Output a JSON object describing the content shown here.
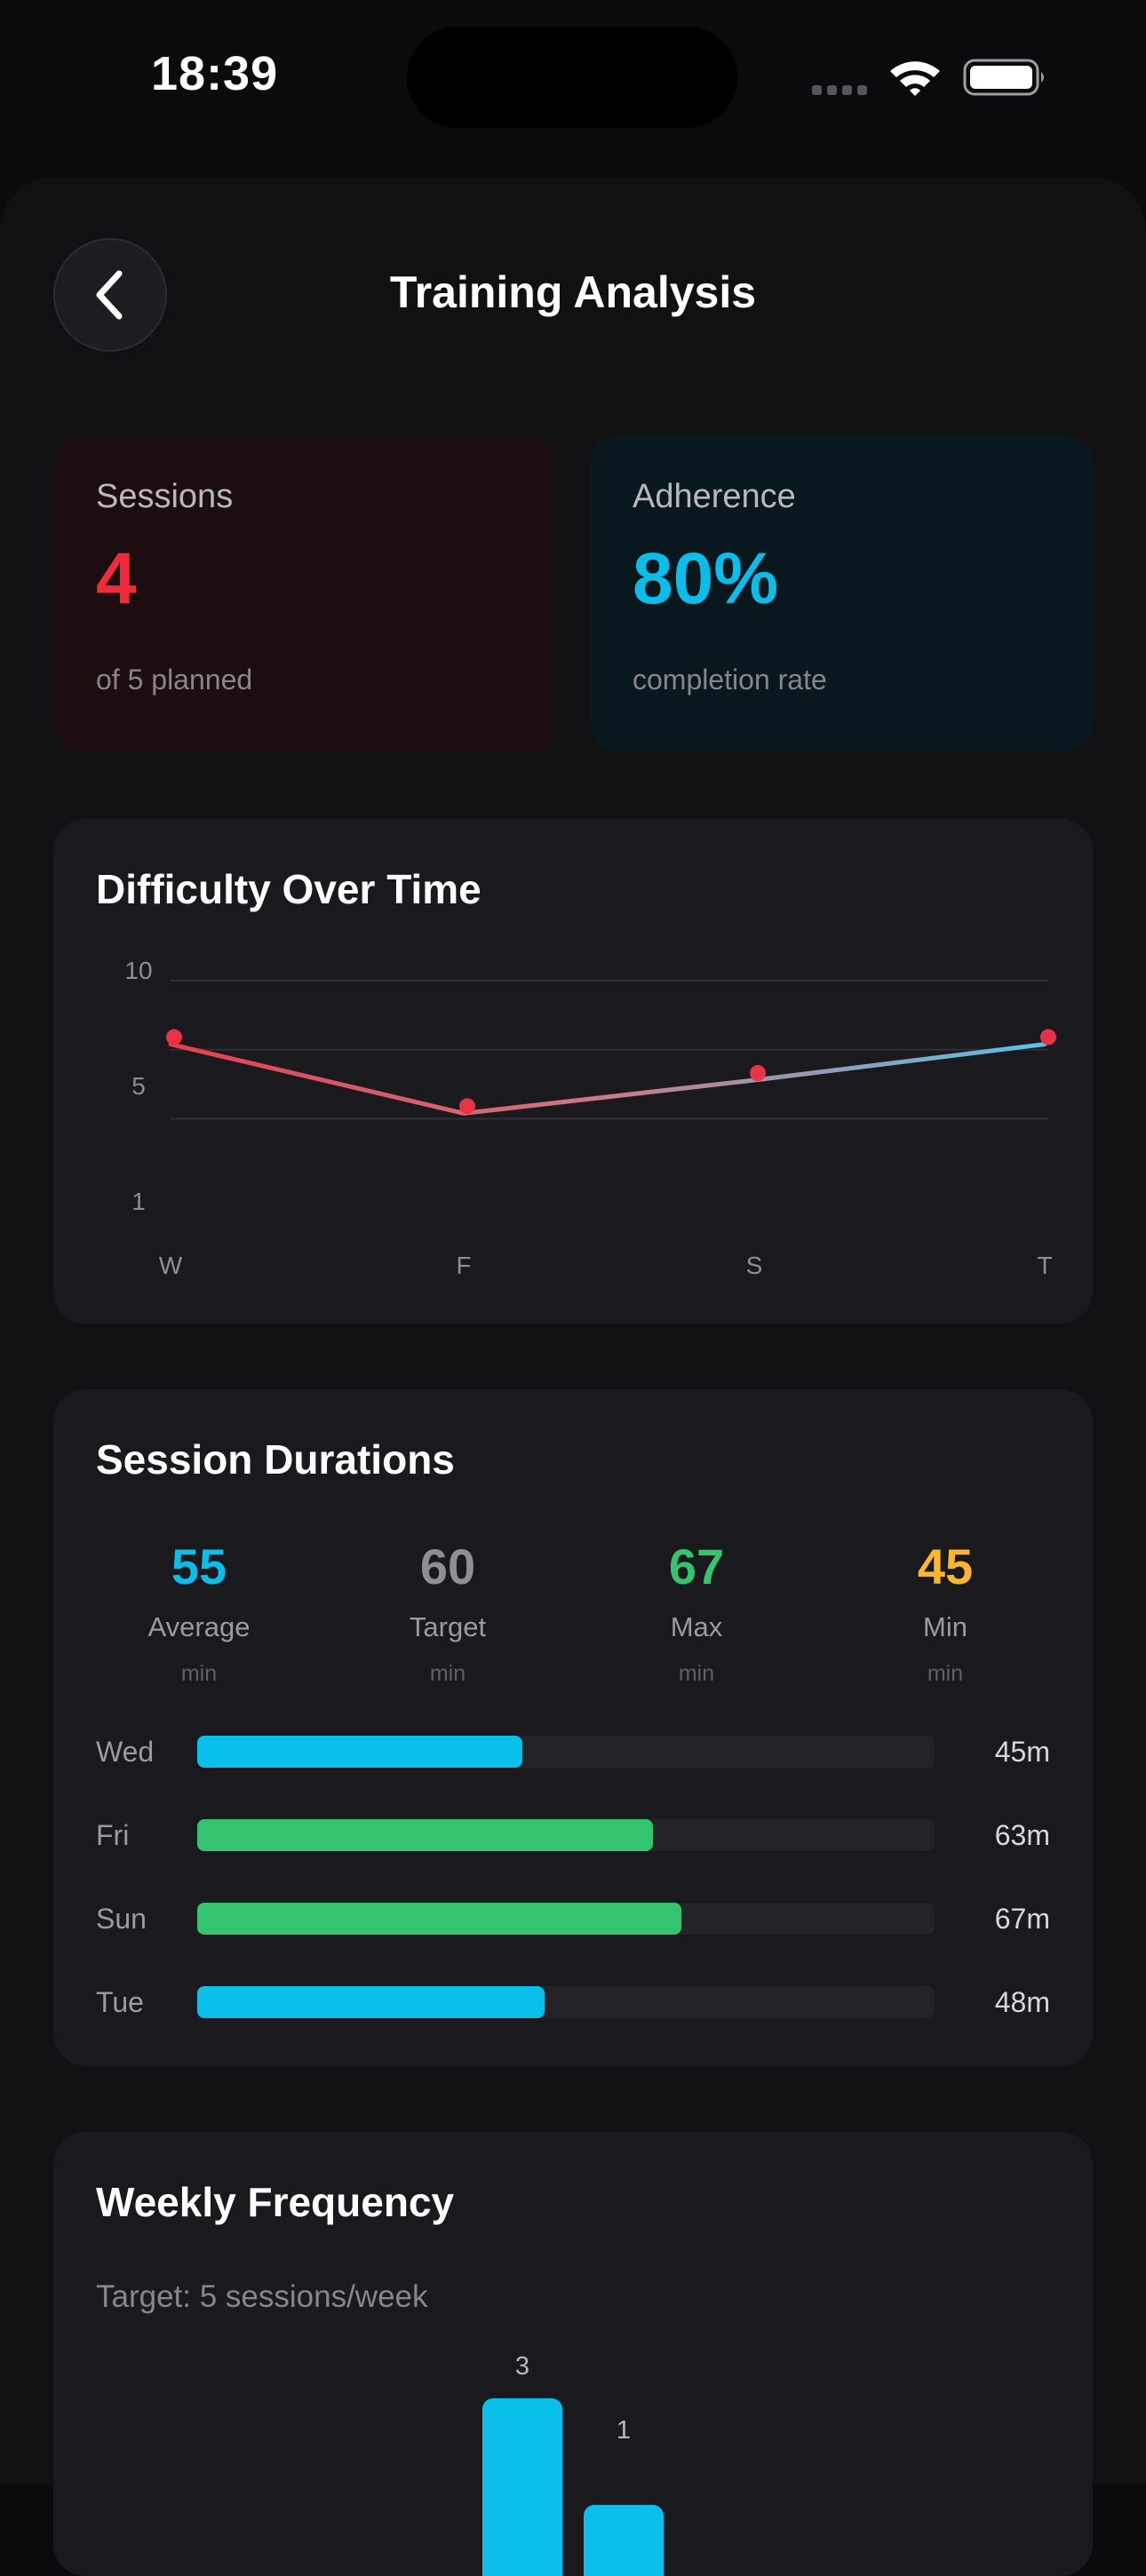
{
  "status_bar": {
    "time": "18:39"
  },
  "header": {
    "title": "Training Analysis"
  },
  "stats": {
    "sessions": {
      "label": "Sessions",
      "value": "4",
      "sub": "of 5 planned",
      "color": "#ef2b3b"
    },
    "adherence": {
      "label": "Adherence",
      "value": "80%",
      "sub": "completion rate",
      "color": "#0bbde8"
    }
  },
  "difficulty": {
    "title": "Difficulty Over Time",
    "y_ticks": [
      "10",
      "5",
      "1"
    ],
    "x_labels": [
      "W",
      "F",
      "S",
      "T"
    ]
  },
  "durations": {
    "title": "Session Durations",
    "metrics": [
      {
        "value": "55",
        "label": "Average",
        "unit": "min",
        "color": "#0bbde8"
      },
      {
        "value": "60",
        "label": "Target",
        "unit": "min",
        "color": "#8e8e93"
      },
      {
        "value": "67",
        "label": "Max",
        "unit": "min",
        "color": "#34c36e"
      },
      {
        "value": "45",
        "label": "Min",
        "unit": "min",
        "color": "#f9b62e"
      }
    ],
    "rows": [
      {
        "day": "Wed",
        "value": "45m",
        "minutes": 45,
        "color": "#0abfea"
      },
      {
        "day": "Fri",
        "value": "63m",
        "minutes": 63,
        "color": "#34c36e"
      },
      {
        "day": "Sun",
        "value": "67m",
        "minutes": 67,
        "color": "#34c36e"
      },
      {
        "day": "Tue",
        "value": "48m",
        "minutes": 48,
        "color": "#0abfea"
      }
    ]
  },
  "weekly": {
    "title": "Weekly Frequency",
    "target_text": "Target: 5 sessions/week",
    "bars": [
      {
        "label": "3",
        "value": 3
      },
      {
        "label": "1",
        "value": 1
      }
    ]
  },
  "chart_data": {
    "type": "line",
    "title": "Difficulty Over Time",
    "categories": [
      "W",
      "F",
      "S",
      "T"
    ],
    "y_ticks": [
      10,
      5,
      1
    ],
    "ylim": [
      1,
      10
    ],
    "series": [
      {
        "values": [
          7.7,
          5.2,
          6.4,
          7.7
        ],
        "color_start": "#e5404f",
        "color_end": "#5bc0e6"
      }
    ],
    "grid": true
  }
}
